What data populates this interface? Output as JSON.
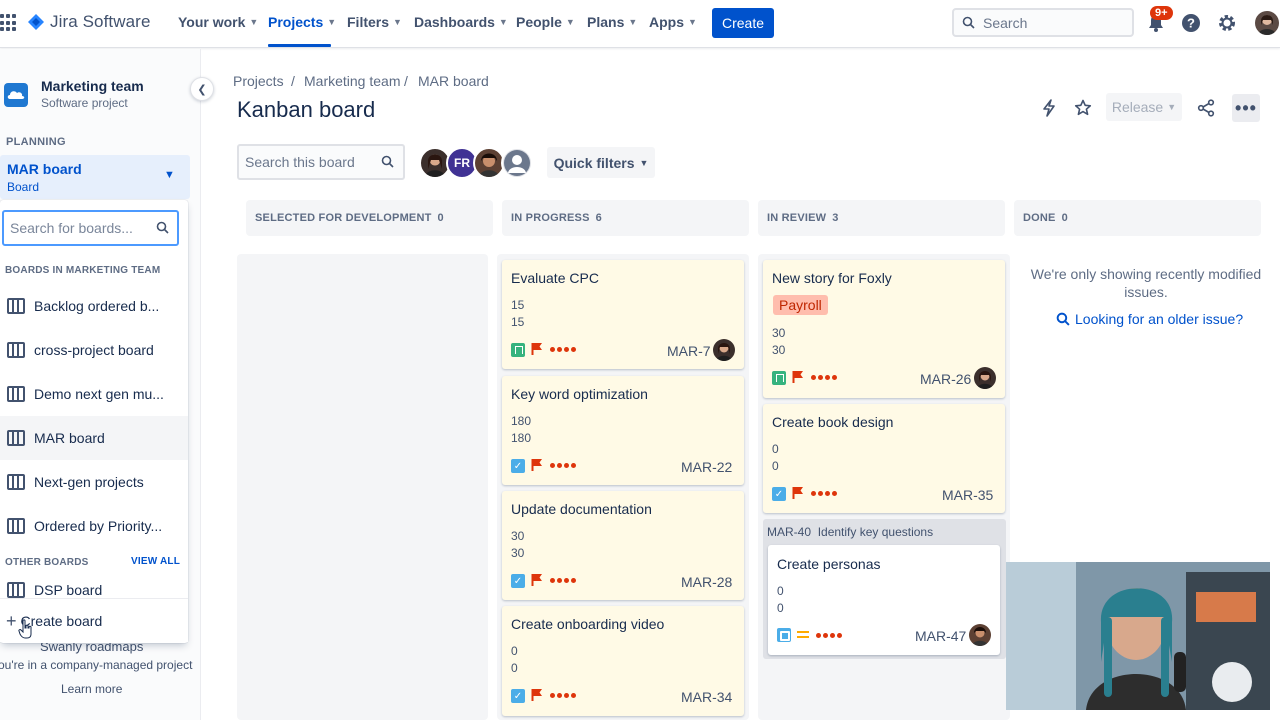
{
  "topnav": {
    "logo": "Jira Software",
    "items": [
      "Your work",
      "Projects",
      "Filters",
      "Dashboards",
      "People",
      "Plans",
      "Apps"
    ],
    "create": "Create",
    "search_placeholder": "Search",
    "notifications_badge": "9+"
  },
  "sidebar": {
    "project_name": "Marketing team",
    "project_type": "Software project",
    "planning": "PLANNING",
    "board_name": "MAR board",
    "board_type": "Board",
    "dropdown": {
      "search_placeholder": "Search for boards...",
      "boards_heading": "BOARDS IN MARKETING TEAM",
      "boards": [
        "Backlog ordered b...",
        "cross-project board",
        "Demo next gen mu...",
        "MAR board",
        "Next-gen projects",
        "Ordered by Priority..."
      ],
      "other_heading": "OTHER BOARDS",
      "view_all": "VIEW ALL",
      "other_boards": [
        "DSP board"
      ],
      "create_board": "Create board"
    },
    "partial_item": "Swanly roadmaps",
    "company_msg": "ou're in a company-managed project",
    "learn_more": "Learn more"
  },
  "breadcrumb": [
    "Projects",
    "Marketing team",
    "MAR board"
  ],
  "title": "Kanban board",
  "release": "Release",
  "board_search_placeholder": "Search this board",
  "avatar_initials": "FR",
  "quick_filters": "Quick filters",
  "columns": [
    {
      "name": "SELECTED FOR DEVELOPMENT",
      "count": "0"
    },
    {
      "name": "IN PROGRESS",
      "count": "6"
    },
    {
      "name": "IN REVIEW",
      "count": "3"
    },
    {
      "name": "DONE",
      "count": "0"
    }
  ],
  "cards": {
    "c1": {
      "title": "Evaluate CPC",
      "n1": "15",
      "n2": "15",
      "key": "MAR-7"
    },
    "c2": {
      "title": "Key word optimization",
      "n1": "180",
      "n2": "180",
      "key": "MAR-22"
    },
    "c3": {
      "title": "Update documentation",
      "n1": "30",
      "n2": "30",
      "key": "MAR-28"
    },
    "c4": {
      "title": "Create onboarding video",
      "n1": "0",
      "n2": "0",
      "key": "MAR-34"
    },
    "r1": {
      "title": "New story for Foxly",
      "label": "Payroll",
      "n1": "30",
      "n2": "30",
      "key": "MAR-26"
    },
    "r2": {
      "title": "Create book design",
      "n1": "0",
      "n2": "0",
      "key": "MAR-35"
    },
    "parent": {
      "key": "MAR-40",
      "title": "Identify key questions"
    },
    "r3": {
      "title": "Create personas",
      "n1": "0",
      "n2": "0",
      "key": "MAR-47"
    }
  },
  "done_msg": "We're only showing recently modified issues.",
  "older_link": "Looking for an older issue?",
  "colors": {
    "accent": "#0052cc",
    "flag": "#de350b",
    "card": "#fffae6"
  }
}
